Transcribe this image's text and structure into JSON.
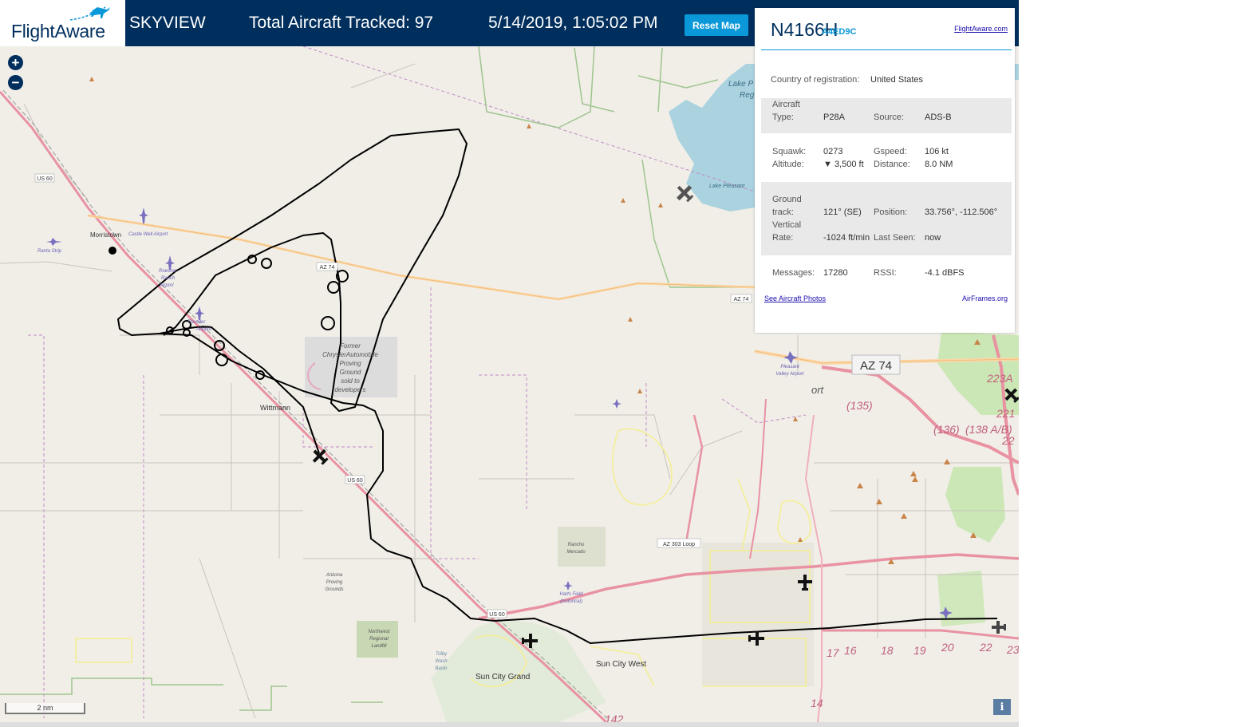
{
  "header": {
    "logo_text": "FlightAware",
    "app_name": "SKYVIEW",
    "total_tracked": "Total Aircraft Tracked: 97",
    "timestamp": "5/14/2019, 1:05:02 PM",
    "reset_label": "Reset Map"
  },
  "map_controls": {
    "zoom_in": "+",
    "zoom_out": "−",
    "scale": "2 nm",
    "info": "i"
  },
  "map_labels": {
    "morristown": "Morristown",
    "wittmann": "Wittmann",
    "sun_city_grand": "Sun City Grand",
    "sun_city_west": "Sun City West",
    "lake_pleasant": "Lake Pleasant",
    "lake_p2": "Lake P",
    "lake_reg": "Reg",
    "castle_well": "Castle Well Airport",
    "ranta": "Ranta Strip",
    "roesner1": "Roesner",
    "roesner2": "Ranch",
    "roesner3": "Airport",
    "thunder1": "Thunder",
    "thunder2": "Airpark",
    "chrysler": [
      "Former",
      "ChryslerAutomobile",
      "Proving",
      "Ground",
      "sold to",
      "developers"
    ],
    "pleasant_valley": [
      "Pleasant",
      "Valley Airport"
    ],
    "rancho": [
      "Rancho",
      "Mercado"
    ],
    "az_proving": [
      "Arizona",
      "Proving",
      "Grounds"
    ],
    "nw_landfill": [
      "Northwest",
      "Regional",
      "Landfill"
    ],
    "trilby": [
      "Trilby",
      "Wash",
      "Basin"
    ],
    "harts": [
      "Harts Field",
      "(historical)"
    ],
    "us60_a": "US 60",
    "us60_b": "US 60",
    "us60_c": "US 60",
    "az74_a": "AZ 74",
    "az74_b": "AZ 74",
    "az74_big": "AZ 74",
    "az303": "AZ 303 Loop",
    "exit_223a": "223A",
    "exit_221": "221",
    "exit_22x": "22",
    "exit_135": "(135)",
    "exit_136": "(136)",
    "exit_138": "(138 A/B)",
    "exits_bottom": [
      "17",
      "16",
      "18",
      "19",
      "20",
      "22",
      "23"
    ],
    "exit_14": "14",
    "exit_142": "142",
    "ort": "ort"
  },
  "aircraft_panel": {
    "ident": "N4166H",
    "hex": "A4ED9C",
    "fa_link": "FlightAware.com",
    "country_label": "Country of registration:",
    "country": "United States",
    "type_label": "Aircraft Type:",
    "type_l1": "Aircraft",
    "type_l2": "Type:",
    "type": "P28A",
    "source_label": "Source:",
    "source": "ADS-B",
    "squawk_label": "Squawk:",
    "squawk": "0273",
    "altitude_label": "Altitude:",
    "altitude": "▼ 3,500 ft",
    "gspeed_label": "Gspeed:",
    "gspeed": "106 kt",
    "distance_label": "Distance:",
    "distance": "8.0 NM",
    "track_l1": "Ground",
    "track_l2": "track:",
    "track": "121° (SE)",
    "position_label": "Position:",
    "position": "33.756°, -112.506°",
    "vrate_l1": "Vertical",
    "vrate_l2": "Rate:",
    "vrate": "-1024 ft/min",
    "lastseen_label": "Last Seen:",
    "lastseen": "now",
    "messages_label": "Messages:",
    "messages": "17280",
    "rssi_label": "RSSI:",
    "rssi": "-4.1 dBFS",
    "photos_link": "See Aircraft Photos",
    "airframes_link": "AirFrames.org"
  },
  "colors": {
    "header": "#002f5d",
    "accent": "#0a98d8",
    "map_bg": "#f1eee8",
    "highway": "#e892a2",
    "primary_road": "#fcd6a4",
    "water": "#aad3df",
    "park": "#c8e6b0",
    "track": "#000000"
  }
}
